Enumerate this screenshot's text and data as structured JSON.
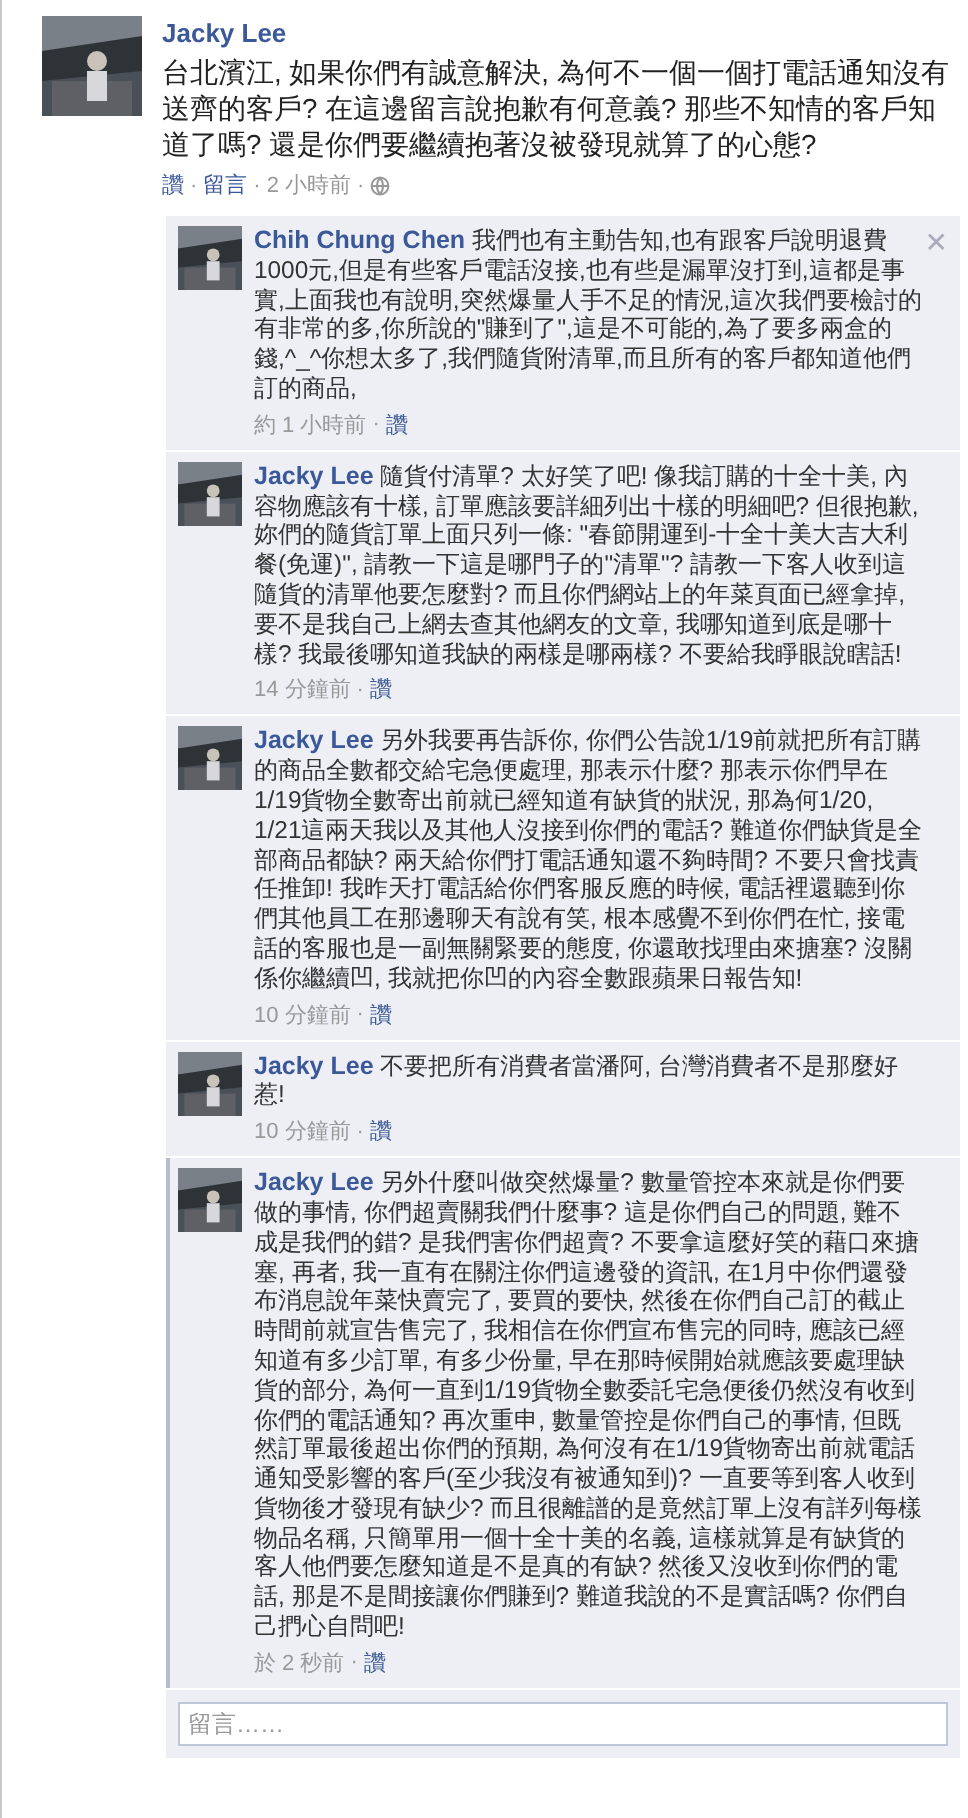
{
  "separator": "·",
  "post": {
    "author": "Jacky Lee",
    "text": "台北濱江, 如果你們有誠意解決, 為何不一個一個打電話通知沒有送齊的客戶? 在這邊留言說抱歉有何意義? 那些不知情的客戶知道了嗎? 還是你們要繼續抱著沒被發現就算了的心態?",
    "meta": [
      {
        "kind": "link",
        "text": "讚"
      },
      {
        "kind": "link",
        "text": "留言"
      },
      {
        "kind": "time",
        "text": "2 小時前"
      },
      {
        "kind": "globe"
      }
    ]
  },
  "replies": [
    {
      "author": "Chih Chung Chen",
      "close": "✕",
      "highlighted": false,
      "text": "我們也有主動告知,也有跟客戶說明退費1000元,但是有些客戶電話沒接,也有些是漏單沒打到,這都是事實,上面我也有說明,突然爆量人手不足的情況,這次我們要檢討的有非常的多,你所說的\"賺到了\",這是不可能的,為了要多兩盒的錢,^_^你想太多了,我們隨貨附清單,而且所有的客戶都知道他們訂的商品,",
      "meta": [
        {
          "kind": "time",
          "text": "約 1 小時前"
        },
        {
          "kind": "link",
          "text": "讚"
        }
      ]
    },
    {
      "author": "Jacky Lee",
      "highlighted": false,
      "text": "隨貨付清單? 太好笑了吧! 像我訂購的十全十美, 內容物應該有十樣, 訂單應該要詳細列出十樣的明細吧? 但很抱歉, 妳們的隨貨訂單上面只列一條: \"春節開運到-十全十美大吉大利餐(免運)\", 請教一下這是哪門子的\"清單\"? 請教一下客人收到這隨貨的清單他要怎麼對? 而且你們網站上的年菜頁面已經拿掉, 要不是我自己上網去查其他網友的文章, 我哪知道到底是哪十樣? 我最後哪知道我缺的兩樣是哪兩樣? 不要給我睜眼說瞎話!",
      "meta": [
        {
          "kind": "time",
          "text": "14 分鐘前"
        },
        {
          "kind": "link",
          "text": "讚"
        }
      ]
    },
    {
      "author": "Jacky Lee",
      "highlighted": false,
      "text": "另外我要再告訴你, 你們公告說1/19前就把所有訂購的商品全數都交給宅急便處理, 那表示什麼? 那表示你們早在1/19貨物全數寄出前就已經知道有缺貨的狀況, 那為何1/20, 1/21這兩天我以及其他人沒接到你們的電話? 難道你們缺貨是全部商品都缺? 兩天給你們打電話通知還不夠時間? 不要只會找責任推卸! 我昨天打電話給你們客服反應的時候, 電話裡還聽到你們其他員工在那邊聊天有說有笑, 根本感覺不到你們在忙, 接電話的客服也是一副無關緊要的態度, 你還敢找理由來搪塞? 沒關係你繼續凹, 我就把你凹的內容全數跟蘋果日報告知!",
      "meta": [
        {
          "kind": "time",
          "text": "10 分鐘前"
        },
        {
          "kind": "link",
          "text": "讚"
        }
      ]
    },
    {
      "author": "Jacky Lee",
      "highlighted": false,
      "text": "不要把所有消費者當潘阿, 台灣消費者不是那麼好惹!",
      "meta": [
        {
          "kind": "time",
          "text": "10 分鐘前"
        },
        {
          "kind": "link",
          "text": "讚"
        }
      ]
    },
    {
      "author": "Jacky Lee",
      "highlighted": true,
      "text": "另外什麼叫做突然爆量? 數量管控本來就是你們要做的事情, 你們超賣關我們什麼事? 這是你們自己的問題, 難不成是我們的錯? 是我們害你們超賣? 不要拿這麼好笑的藉口來搪塞, 再者, 我一直有在關注你們這邊發的資訊, 在1月中你們還發布消息說年菜快賣完了, 要買的要快, 然後在你們自己訂的截止時間前就宣告售完了, 我相信在你們宣布售完的同時, 應該已經知道有多少訂單, 有多少份量, 早在那時候開始就應該要處理缺貨的部分, 為何一直到1/19貨物全數委託宅急便後仍然沒有收到你們的電話通知? 再次重申, 數量管控是你們自己的事情, 但既然訂單最後超出你們的預期, 為何沒有在1/19貨物寄出前就電話通知受影響的客戶(至少我沒有被通知到)? 一直要等到客人收到貨物後才發現有缺少? 而且很離譜的是竟然訂單上沒有詳列每樣物品名稱, 只簡單用一個十全十美的名義, 這樣就算是有缺貨的客人他們要怎麼知道是不是真的有缺? 然後又沒收到你們的電話, 那是不是間接讓你們賺到? 難道我說的不是實話嗎? 你們自己捫心自問吧!",
      "meta": [
        {
          "kind": "time",
          "text": "於 2 秒前"
        },
        {
          "kind": "link",
          "text": "讚"
        }
      ]
    }
  ],
  "comment_box": {
    "placeholder": "留言……"
  }
}
